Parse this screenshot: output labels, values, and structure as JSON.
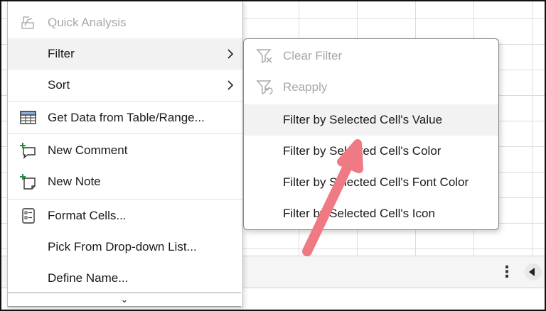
{
  "context_menu": {
    "items": [
      {
        "label": "Quick Analysis",
        "disabled": true
      },
      {
        "label": "Filter",
        "has_submenu": true
      },
      {
        "label": "Sort",
        "has_submenu": true
      },
      {
        "label": "Get Data from Table/Range..."
      },
      {
        "label": "New Comment"
      },
      {
        "label": "New Note"
      },
      {
        "label": "Format Cells..."
      },
      {
        "label": "Pick From Drop-down List..."
      },
      {
        "label": "Define Name..."
      }
    ],
    "more_glyph": "⌄"
  },
  "filter_submenu": {
    "items": [
      {
        "label": "Clear Filter",
        "disabled": true
      },
      {
        "label": "Reapply",
        "disabled": true
      },
      {
        "label": "Filter by Selected Cell's Value"
      },
      {
        "label": "Filter by Selected Cell's Color"
      },
      {
        "label": "Filter by Selected Cell's Font Color"
      },
      {
        "label": "Filter by Selected Cell's Icon"
      }
    ]
  },
  "status_bar": {
    "more_glyph": "⋮"
  },
  "colors": {
    "annotation_arrow": "#f07a84",
    "accent_green": "#1e8e3e",
    "icon_gray": "#a8a8a8"
  }
}
